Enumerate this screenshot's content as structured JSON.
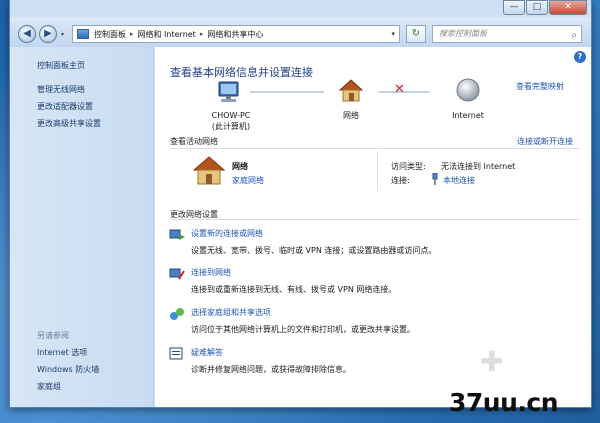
{
  "window": {
    "minimize": "—",
    "maximize": "□",
    "close": "✕"
  },
  "nav": {
    "back": "◀",
    "forward": "▶",
    "history": "▾",
    "breadcrumbs": [
      "控制面板",
      "网络和 Internet",
      "网络和共享中心"
    ],
    "separator": "▸",
    "address_dropdown": "▾",
    "refresh": "↻",
    "search_placeholder": "搜索控制面板",
    "search_icon": "⌕"
  },
  "sidebar": {
    "items": [
      {
        "label": "控制面板主页"
      },
      {
        "label": "管理无线网络"
      },
      {
        "label": "更改适配器设置"
      },
      {
        "label": "更改高级共享设置"
      }
    ],
    "see_also_label": "另请参阅",
    "see_also": [
      {
        "label": "Internet 选项"
      },
      {
        "label": "Windows 防火墙"
      },
      {
        "label": "家庭组"
      }
    ]
  },
  "main": {
    "help": "?",
    "title": "查看基本网络信息并设置连接",
    "full_map": "查看完整映射",
    "map": {
      "computer_name": "CHOW-PC",
      "computer_caption": "(此计算机)",
      "network": "网络",
      "internet": "Internet",
      "disconnected_mark": "✕"
    },
    "active_networks_label": "查看活动网络",
    "connect_disconnect": "连接或断开连接",
    "active_network": {
      "name": "网络",
      "type": "家庭网络",
      "access_type_label": "访问类型:",
      "access_type_value": "无法连接到 Internet",
      "connections_label": "连接:",
      "connections_value": "本地连接"
    },
    "change_settings_label": "更改网络设置",
    "tasks": [
      {
        "title": "设置新的连接或网络",
        "desc": "设置无线、宽带、拨号、临时或 VPN 连接；或设置路由器或访问点。"
      },
      {
        "title": "连接到网络",
        "desc": "连接到或重新连接到无线、有线、拨号或 VPN 网络连接。"
      },
      {
        "title": "选择家庭组和共享选项",
        "desc": "访问位于其他网络计算机上的文件和打印机，或更改共享设置。"
      },
      {
        "title": "疑难解答",
        "desc": "诊断并修复网络问题，或获得故障排除信息。"
      }
    ]
  },
  "watermark": "37uu.cn",
  "colors": {
    "link": "#1d55b3",
    "title": "#1f3f8a",
    "sidebar_bg": "#cfe0f3",
    "error": "#d2252a"
  }
}
